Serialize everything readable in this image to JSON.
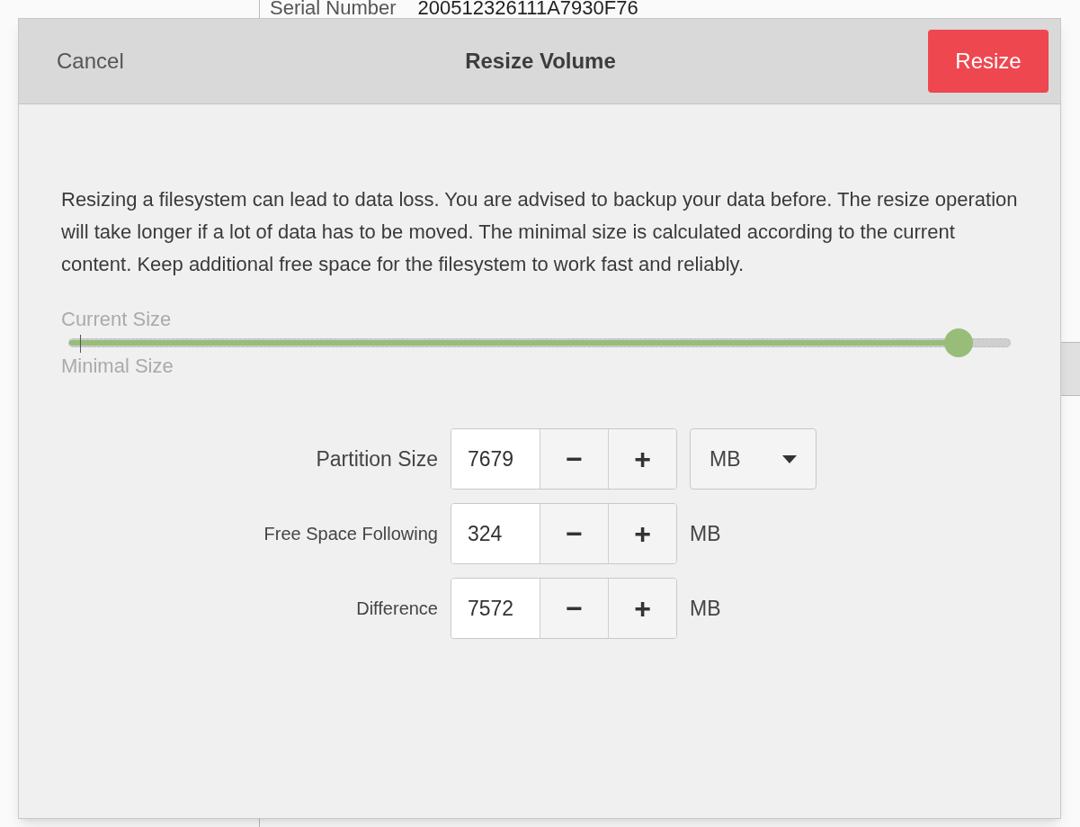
{
  "background_window": {
    "label": "Serial Number",
    "value": "200512326111A7930F76"
  },
  "dialog": {
    "title": "Resize Volume",
    "cancel_button": "Cancel",
    "confirm_button": "Resize",
    "description": "Resizing a filesystem can lead to data loss. You are advised to backup your data before. The resize operation will take longer if a lot of data has to be moved. The minimal size is calculated according to the current content. Keep additional free space for the filesystem to work fast and reliably.",
    "slider": {
      "top_label": "Current Size",
      "bottom_label": "Minimal Size",
      "level": 0.945
    },
    "fields": [
      {
        "label": "Partition Size",
        "value": "7679",
        "decrement": "−",
        "increment": "+",
        "unit": "MB",
        "kind": "dropdown"
      },
      {
        "label": "Free Space Following",
        "value": "324",
        "decrement": "−",
        "increment": "+",
        "unit": "MB",
        "kind": "text"
      },
      {
        "label": "Difference",
        "value": "7572",
        "decrement": "−",
        "increment": "+",
        "unit": "MB",
        "kind": "text"
      }
    ]
  }
}
